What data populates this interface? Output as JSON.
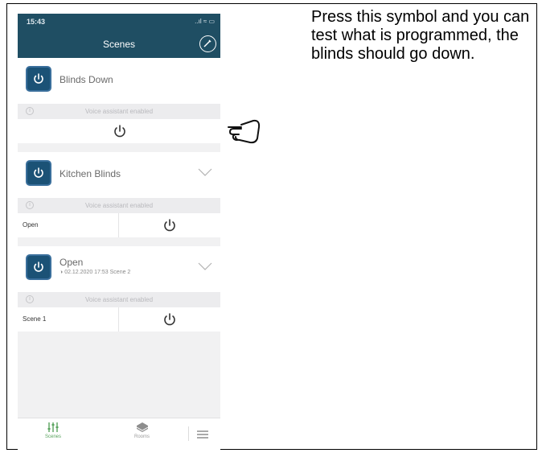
{
  "status_bar": {
    "time": "15:43",
    "icons_text": "..ıl ≈ ▭"
  },
  "nav": {
    "title": "Scenes"
  },
  "scenes": [
    {
      "name": "Blinds Down",
      "voice": "Voice assistant enabled"
    },
    {
      "name": "Kitchen Blinds",
      "voice": "Voice assistant enabled",
      "action_label": "Open"
    },
    {
      "name": "Open",
      "subtitle": "02.12.2020  17:53  Scene 2",
      "voice": "Voice assistant enabled",
      "action_label": "Scene 1"
    }
  ],
  "info_glyph": "i",
  "tabs": {
    "scenes": "Scenes",
    "rooms": "Rooms"
  },
  "instruction": "Press this symbol and you can test what is programmed, the blinds should go down.",
  "colors": {
    "header": "#1f4e63",
    "accent": "#58a35d",
    "scene_icon": "#1b5276"
  }
}
